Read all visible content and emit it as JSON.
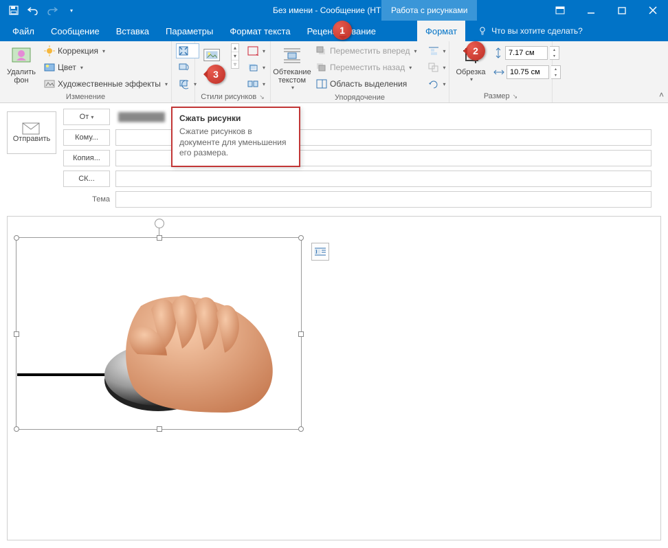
{
  "titlebar": {
    "title": "Без имени - Сообщение (HTML)",
    "context_title": "Работа с рисунками"
  },
  "tabs": {
    "file": "Файл",
    "message": "Сообщение",
    "insert": "Вставка",
    "options": "Параметры",
    "format_text": "Формат текста",
    "review": "Рецензирование",
    "format": "Формат",
    "tellme": "Что вы хотите сделать?"
  },
  "ribbon": {
    "remove_bg": "Удалить фон",
    "corrections": "Коррекция",
    "color": "Цвет",
    "artistic": "Художественные эффекты",
    "group_change": "Изменение",
    "group_styles": "Стили рисунков",
    "wrap_text": "Обтекание текстом",
    "bring_forward": "Переместить вперед",
    "send_backward": "Переместить назад",
    "selection_pane": "Область выделения",
    "group_arrange": "Упорядочение",
    "crop": "Обрезка",
    "group_size": "Размер",
    "height_value": "7.17 см",
    "width_value": "10.75 см"
  },
  "tooltip": {
    "title": "Сжать рисунки",
    "body": "Сжатие рисунков в документе для уменьшения его размера."
  },
  "callouts": {
    "c1": "1",
    "c2": "2",
    "c3": "3"
  },
  "compose": {
    "send": "Отправить",
    "from": "От",
    "to": "Кому...",
    "cc": "Копия...",
    "bcc": "СК...",
    "subject_label": "Тема"
  }
}
